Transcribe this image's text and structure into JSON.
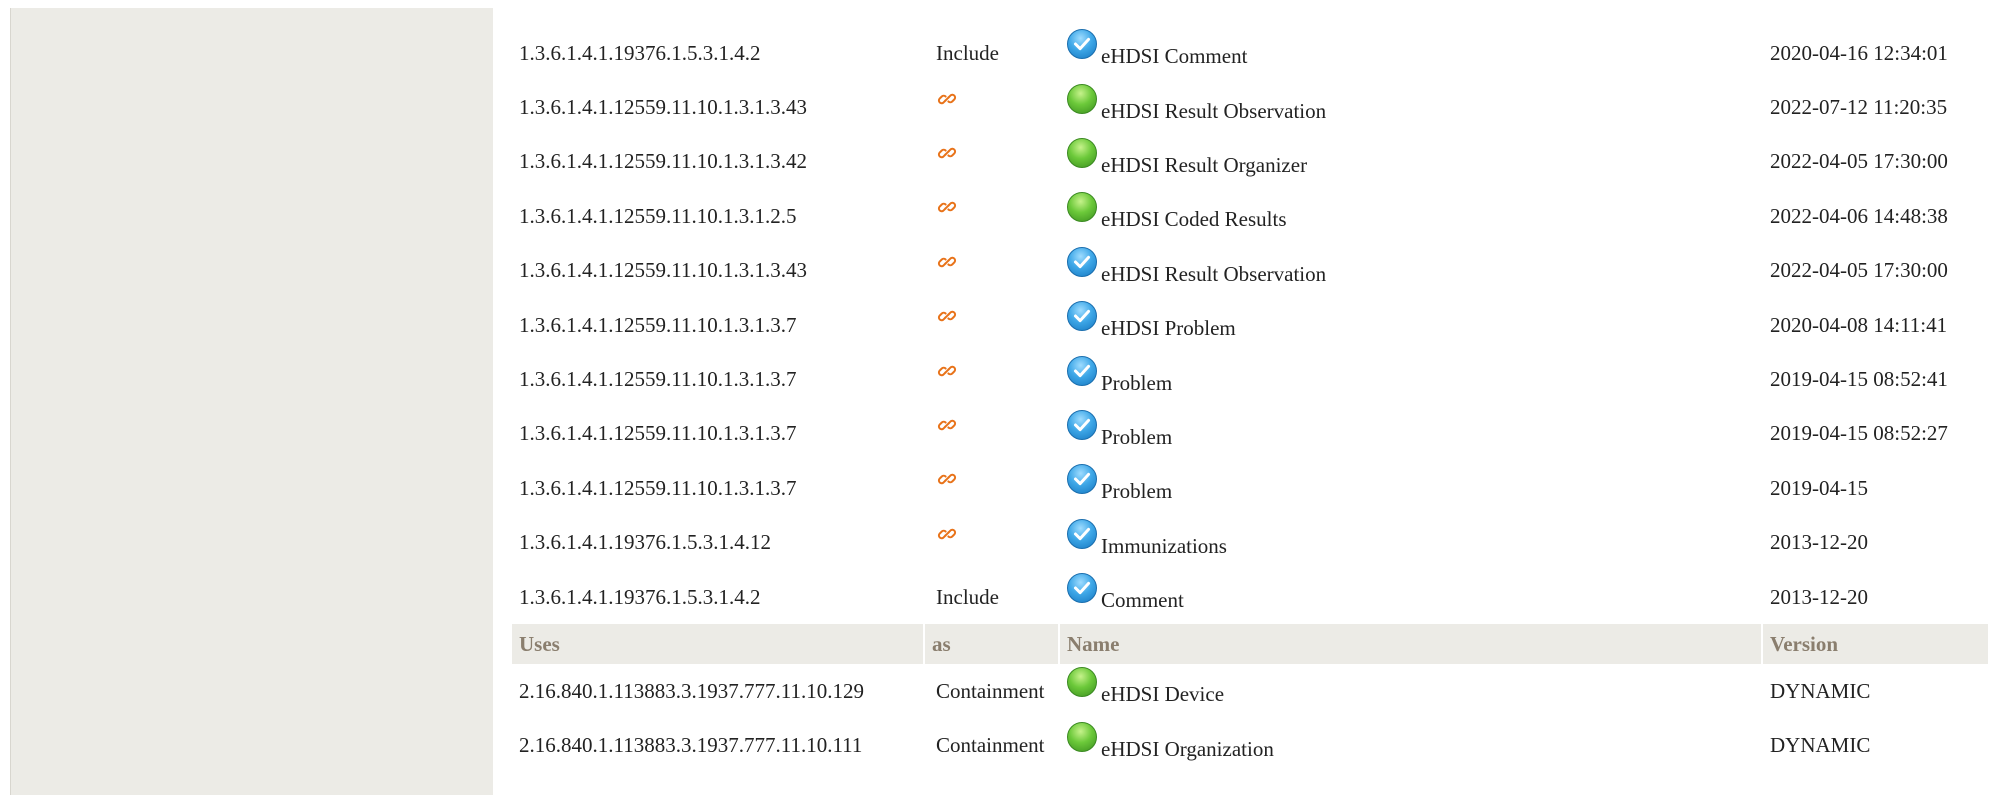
{
  "rows": [
    {
      "id": "1.3.6.1.4.1.19376.1.5.3.1.4.2",
      "type": "Include",
      "status": "blue",
      "name": "eHDSI Comment",
      "version": "2020-04-16 12:34:01"
    },
    {
      "id": "1.3.6.1.4.1.12559.11.10.1.3.1.3.43",
      "type": "",
      "status": "green",
      "name": "eHDSI Result Observation",
      "version": "2022-07-12 11:20:35"
    },
    {
      "id": "1.3.6.1.4.1.12559.11.10.1.3.1.3.42",
      "type": "",
      "status": "green",
      "name": "eHDSI Result Organizer",
      "version": "2022-04-05 17:30:00"
    },
    {
      "id": "1.3.6.1.4.1.12559.11.10.1.3.1.2.5",
      "type": "",
      "status": "green",
      "name": "eHDSI Coded Results",
      "version": "2022-04-06 14:48:38"
    },
    {
      "id": "1.3.6.1.4.1.12559.11.10.1.3.1.3.43",
      "type": "",
      "status": "blue",
      "name": "eHDSI Result Observation",
      "version": "2022-04-05 17:30:00"
    },
    {
      "id": "1.3.6.1.4.1.12559.11.10.1.3.1.3.7",
      "type": "",
      "status": "blue",
      "name": "eHDSI Problem",
      "version": "2020-04-08 14:11:41"
    },
    {
      "id": "1.3.6.1.4.1.12559.11.10.1.3.1.3.7",
      "type": "",
      "status": "blue",
      "name": "Problem",
      "version": "2019-04-15 08:52:41"
    },
    {
      "id": "1.3.6.1.4.1.12559.11.10.1.3.1.3.7",
      "type": "",
      "status": "blue",
      "name": "Problem",
      "version": "2019-04-15 08:52:27"
    },
    {
      "id": "1.3.6.1.4.1.12559.11.10.1.3.1.3.7",
      "type": "",
      "status": "blue",
      "name": "Problem",
      "version": "2019-04-15"
    },
    {
      "id": "1.3.6.1.4.1.19376.1.5.3.1.4.12",
      "type": "",
      "status": "blue",
      "name": "Immunizations",
      "version": "2013-12-20"
    },
    {
      "id": "1.3.6.1.4.1.19376.1.5.3.1.4.2",
      "type": "Include",
      "status": "blue",
      "name": "Comment",
      "version": "2013-12-20"
    }
  ],
  "uses_header": {
    "uses": "Uses",
    "as": "as",
    "name": "Name",
    "version": "Version"
  },
  "uses_rows": [
    {
      "id": "2.16.840.1.113883.3.1937.777.11.10.129",
      "type": "Containment",
      "status": "green",
      "name": "eHDSI Device",
      "version": "DYNAMIC"
    },
    {
      "id": "2.16.840.1.113883.3.1937.777.11.10.111",
      "type": "Containment",
      "status": "green",
      "name": "eHDSI Organization",
      "version": "DYNAMIC"
    }
  ],
  "icons": {
    "link": "link-icon",
    "status_blue": "check-circle-blue-icon",
    "status_green": "green-circle-icon"
  },
  "colors": {
    "header_bg": "#ecebe6",
    "header_text": "#8a7e6e",
    "link_icon": "#e8731a",
    "sidebar_bg": "#ecebe6"
  }
}
